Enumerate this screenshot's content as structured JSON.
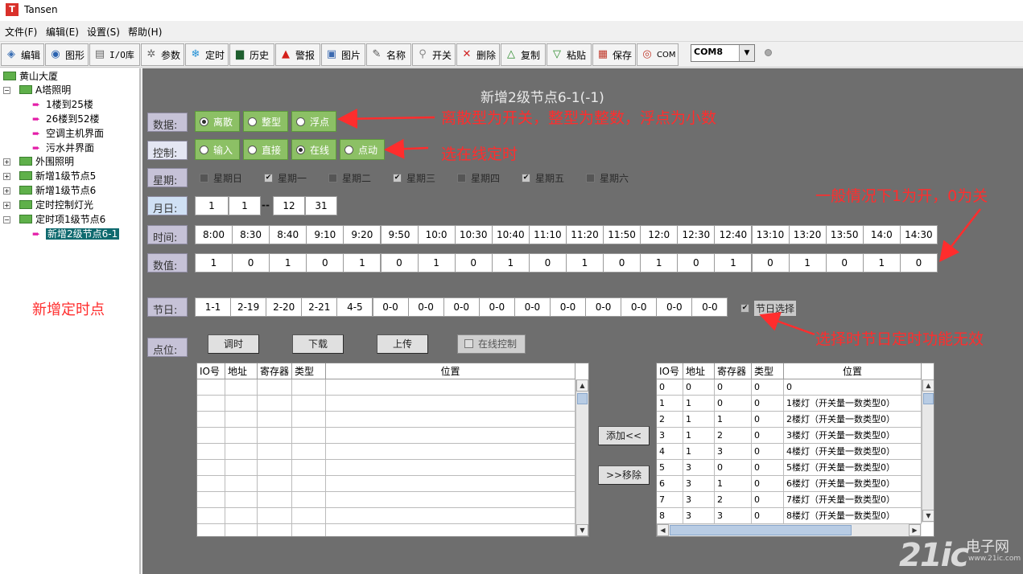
{
  "window": {
    "title": "Tansen",
    "app_icon_letter": "T"
  },
  "menu": [
    "文件(F)",
    "编辑(E)",
    "设置(S)",
    "帮助(H)"
  ],
  "toolbar": [
    {
      "label": "编辑",
      "icon": "edit-icon"
    },
    {
      "label": "图形",
      "icon": "globe-icon"
    },
    {
      "label": "I/O库",
      "icon": "io-library-icon"
    },
    {
      "label": "参数",
      "icon": "gear-icon"
    },
    {
      "label": "定时",
      "icon": "snowflake-icon"
    },
    {
      "label": "历史",
      "icon": "monitor-icon"
    },
    {
      "label": "警报",
      "icon": "alarm-icon"
    },
    {
      "label": "图片",
      "icon": "image-icon"
    },
    {
      "label": "名称",
      "icon": "pen-icon"
    },
    {
      "label": "开关",
      "icon": "switch-icon"
    },
    {
      "label": "删除",
      "icon": "delete-icon"
    },
    {
      "label": "复制",
      "icon": "copy-icon"
    },
    {
      "label": "粘贴",
      "icon": "paste-icon"
    },
    {
      "label": "保存",
      "icon": "save-icon"
    },
    {
      "label": "COM",
      "icon": "com-icon"
    }
  ],
  "com": {
    "value": "COM8"
  },
  "tree": {
    "root": "黄山大厦",
    "items": [
      {
        "label": "A塔照明",
        "level": 1,
        "expanded": true
      },
      {
        "label": "1楼到25楼",
        "level": 2,
        "leaf": true
      },
      {
        "label": "26楼到52楼",
        "level": 2,
        "leaf": true
      },
      {
        "label": "空调主机界面",
        "level": 2,
        "leaf": true
      },
      {
        "label": "污水井界面",
        "level": 2,
        "leaf": true
      },
      {
        "label": "外围照明",
        "level": 1
      },
      {
        "label": "新增1级节点5",
        "level": 1
      },
      {
        "label": "新增1级节点6",
        "level": 1
      },
      {
        "label": "定时控制灯光",
        "level": 1
      },
      {
        "label": "定时项1级节点6",
        "level": 1,
        "expanded": true
      },
      {
        "label": "新增2级节点6-1",
        "level": 2,
        "leaf": true,
        "selected": true
      }
    ],
    "annotation": "新增定时点"
  },
  "form": {
    "title": "新增2级节点6-1(-1)",
    "data_label": "数据:",
    "data_options": [
      {
        "label": "离散",
        "checked": true
      },
      {
        "label": "整型",
        "checked": false
      },
      {
        "label": "浮点",
        "checked": false
      }
    ],
    "control_label": "控制:",
    "control_options": [
      {
        "label": "输入",
        "checked": false
      },
      {
        "label": "直接",
        "checked": false
      },
      {
        "label": "在线",
        "checked": true
      },
      {
        "label": "点动",
        "checked": false
      }
    ],
    "week_label": "星期:",
    "week_days": [
      {
        "label": "星期日",
        "checked": false
      },
      {
        "label": "星期一",
        "checked": true
      },
      {
        "label": "星期二",
        "checked": false
      },
      {
        "label": "星期三",
        "checked": true
      },
      {
        "label": "星期四",
        "checked": false
      },
      {
        "label": "星期五",
        "checked": true
      },
      {
        "label": "星期六",
        "checked": false
      }
    ],
    "date_label": "月日:",
    "date_from": [
      "1",
      "1"
    ],
    "date_sep": "--",
    "date_to": [
      "12",
      "31"
    ],
    "time_label": "时间:",
    "times": [
      "8:00",
      "8:30",
      "8:40",
      "9:10",
      "9:20",
      "9:50",
      "10:0",
      "10:30",
      "10:40",
      "11:10",
      "11:20",
      "11:50",
      "12:0",
      "12:30",
      "12:40",
      "13:10",
      "13:20",
      "13:50",
      "14:0",
      "14:30"
    ],
    "value_label": "数值:",
    "values": [
      "1",
      "0",
      "1",
      "0",
      "1",
      "0",
      "1",
      "0",
      "1",
      "0",
      "1",
      "0",
      "1",
      "0",
      "1",
      "0",
      "1",
      "0",
      "1",
      "0"
    ],
    "holiday_label": "节日:",
    "holidays": [
      "1-1",
      "2-19",
      "2-20",
      "2-21",
      "4-5",
      "0-0",
      "0-0",
      "0-0",
      "0-0",
      "0-0",
      "0-0",
      "0-0",
      "0-0",
      "0-0",
      "0-0"
    ],
    "holiday_select": {
      "label": "节日选择",
      "checked": true
    },
    "point_label": "点位:",
    "buttons": {
      "adjust": "调时",
      "download": "下载",
      "upload": "上传",
      "online_control": "在线控制",
      "add": "添加<<",
      "remove": ">>移除"
    }
  },
  "left_table": {
    "columns": [
      "IO号",
      "地址",
      "寄存器",
      "类型",
      "位置"
    ],
    "rows": []
  },
  "right_table": {
    "columns": [
      "IO号",
      "地址",
      "寄存器",
      "类型",
      "位置"
    ],
    "rows": [
      [
        "0",
        "0",
        "0",
        "0",
        "0"
      ],
      [
        "1",
        "1",
        "0",
        "0",
        "1楼灯（开关量一数类型0）"
      ],
      [
        "2",
        "1",
        "1",
        "0",
        "2楼灯（开关量一数类型0）"
      ],
      [
        "3",
        "1",
        "2",
        "0",
        "3楼灯（开关量一数类型0）"
      ],
      [
        "4",
        "1",
        "3",
        "0",
        "4楼灯（开关量一数类型0）"
      ],
      [
        "5",
        "3",
        "0",
        "0",
        "5楼灯（开关量一数类型0）"
      ],
      [
        "6",
        "3",
        "1",
        "0",
        "6楼灯（开关量一数类型0）"
      ],
      [
        "7",
        "3",
        "2",
        "0",
        "7楼灯（开关量一数类型0）"
      ],
      [
        "8",
        "3",
        "3",
        "0",
        "8楼灯（开关量一数类型0）"
      ]
    ]
  },
  "annotations": {
    "data_type": "离散型为开关，整型为整数，浮点为小数",
    "control": "选在线定时",
    "value_hint": "一般情况下1为开，0为关",
    "holiday_hint": "选择时节日定时功能无效"
  },
  "watermark": {
    "brand": "21ic",
    "sub": "电子网",
    "url": "www.21ic.com"
  }
}
